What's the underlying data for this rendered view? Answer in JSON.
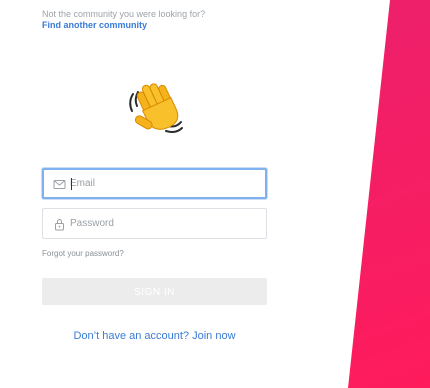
{
  "community": {
    "hint": "Not the community you were looking for?",
    "link": "Find another community"
  },
  "icons": {
    "greeting": "waving-hand-icon",
    "email": "envelope-icon",
    "password": "lock-icon"
  },
  "form": {
    "email_placeholder": "Email",
    "email_value": "",
    "password_placeholder": "Password",
    "password_value": "",
    "forgot_label": "Forgot your password?",
    "signin_label": "SIGN IN"
  },
  "signup": {
    "label": "Don’t have an account? Join now"
  },
  "colors": {
    "accent_link": "#3a7bd5",
    "focus_ring": "#7fb1ef",
    "brand_panel": "#f01f68",
    "button_disabled": "#ececec"
  }
}
